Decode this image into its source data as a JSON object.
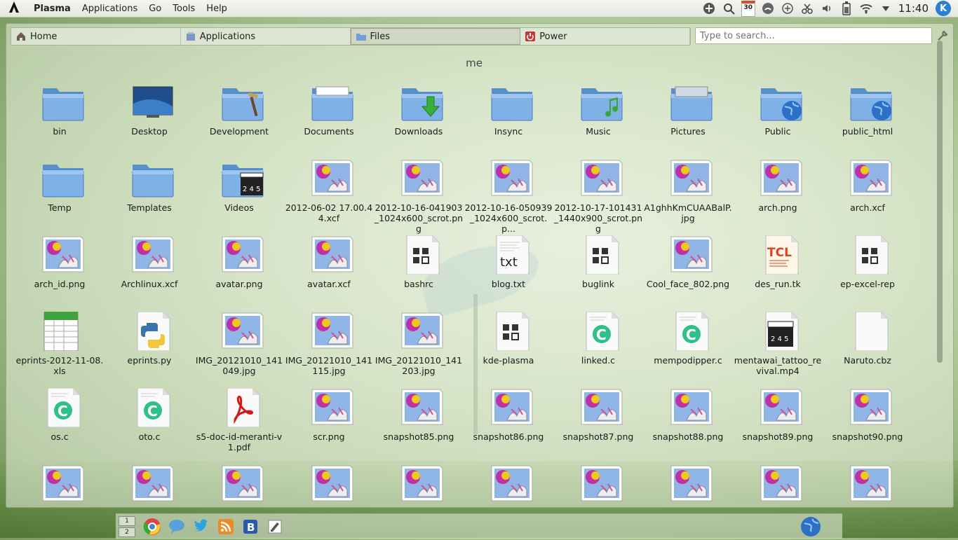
{
  "menubar": {
    "app_name": "Plasma",
    "menus": [
      "Applications",
      "Go",
      "Tools",
      "Help"
    ],
    "clock": "11:40",
    "calendar_day": "30",
    "tray_icons": [
      "add-icon",
      "search-people-icon",
      "calendar-icon",
      "network-manager-icon",
      "plus-circle-icon",
      "scissors-icon",
      "volume-icon",
      "battery-icon",
      "wifi-icon",
      "expand-arrow-icon"
    ],
    "kde_badge": "K"
  },
  "launcher": {
    "tabs": [
      {
        "label": "Home",
        "icon": "home-icon"
      },
      {
        "label": "Applications",
        "icon": "applications-icon"
      },
      {
        "label": "Files",
        "icon": "folder-icon",
        "active": true
      },
      {
        "label": "Power",
        "icon": "power-icon"
      }
    ],
    "search_placeholder": "Type to search...",
    "breadcrumb": "me"
  },
  "files": [
    {
      "name": "bin",
      "type": "folder"
    },
    {
      "name": "Desktop",
      "type": "desktop"
    },
    {
      "name": "Development",
      "type": "folder-dev"
    },
    {
      "name": "Documents",
      "type": "folder-docs"
    },
    {
      "name": "Downloads",
      "type": "folder-download"
    },
    {
      "name": "Insync",
      "type": "folder"
    },
    {
      "name": "Music",
      "type": "folder-music"
    },
    {
      "name": "Pictures",
      "type": "folder-pictures"
    },
    {
      "name": "Public",
      "type": "folder-globe"
    },
    {
      "name": "public_html",
      "type": "folder-globe"
    },
    {
      "name": "Temp",
      "type": "folder"
    },
    {
      "name": "Templates",
      "type": "folder"
    },
    {
      "name": "Videos",
      "type": "folder-video"
    },
    {
      "name": "2012-06-02 17.00.44.xcf",
      "type": "image"
    },
    {
      "name": "2012-10-16-041903_1024x600_scrot.png",
      "type": "image"
    },
    {
      "name": "2012-10-16-050939_1024x600_scrot.p...",
      "type": "image"
    },
    {
      "name": "2012-10-17-101431_1440x900_scrot.png",
      "type": "image"
    },
    {
      "name": "A1ghhKmCUAABalP.jpg",
      "type": "image"
    },
    {
      "name": "arch.png",
      "type": "image"
    },
    {
      "name": "arch.xcf",
      "type": "image"
    },
    {
      "name": "arch_id.png",
      "type": "image"
    },
    {
      "name": "Archlinux.xcf",
      "type": "image"
    },
    {
      "name": "avatar.png",
      "type": "image"
    },
    {
      "name": "avatar.xcf",
      "type": "image"
    },
    {
      "name": "bashrc",
      "type": "generic"
    },
    {
      "name": "blog.txt",
      "type": "text"
    },
    {
      "name": "buglink",
      "type": "generic"
    },
    {
      "name": "Cool_face_802.png",
      "type": "image"
    },
    {
      "name": "des_run.tk",
      "type": "tcl"
    },
    {
      "name": "ep-excel-rep",
      "type": "generic"
    },
    {
      "name": "eprints-2012-11-08.xls",
      "type": "spreadsheet"
    },
    {
      "name": "eprints.py",
      "type": "python"
    },
    {
      "name": "IMG_20121010_141049.jpg",
      "type": "image"
    },
    {
      "name": "IMG_20121010_141115.jpg",
      "type": "image"
    },
    {
      "name": "IMG_20121010_141203.jpg",
      "type": "image"
    },
    {
      "name": "kde-plasma",
      "type": "generic"
    },
    {
      "name": "linked.c",
      "type": "csource"
    },
    {
      "name": "mempodipper.c",
      "type": "csource"
    },
    {
      "name": "mentawai_tattoo_revival.mp4",
      "type": "video"
    },
    {
      "name": "Naruto.cbz",
      "type": "blank"
    },
    {
      "name": "os.c",
      "type": "csource"
    },
    {
      "name": "oto.c",
      "type": "csource"
    },
    {
      "name": "s5-doc-id-meranti-v1.pdf",
      "type": "pdf"
    },
    {
      "name": "scr.png",
      "type": "image"
    },
    {
      "name": "snapshot85.png",
      "type": "image"
    },
    {
      "name": "snapshot86.png",
      "type": "image"
    },
    {
      "name": "snapshot87.png",
      "type": "image"
    },
    {
      "name": "snapshot88.png",
      "type": "image"
    },
    {
      "name": "snapshot89.png",
      "type": "image"
    },
    {
      "name": "snapshot90.png",
      "type": "image"
    },
    {
      "name": "",
      "type": "image"
    },
    {
      "name": "",
      "type": "image"
    },
    {
      "name": "",
      "type": "image"
    },
    {
      "name": "",
      "type": "image"
    },
    {
      "name": "",
      "type": "image"
    },
    {
      "name": "",
      "type": "image"
    },
    {
      "name": "",
      "type": "image"
    },
    {
      "name": "",
      "type": "image"
    },
    {
      "name": "",
      "type": "image"
    },
    {
      "name": "",
      "type": "image"
    }
  ],
  "panel": {
    "pager": [
      "1",
      "2"
    ],
    "launchers": [
      "chrome-icon",
      "chat-icon",
      "twitter-icon",
      "rss-icon",
      "blogilo-icon",
      "editor-icon"
    ],
    "tray_right": "globe-icon"
  },
  "colors": {
    "folder_blue": "#6f9fd8",
    "accent": "#2a7fd4"
  }
}
